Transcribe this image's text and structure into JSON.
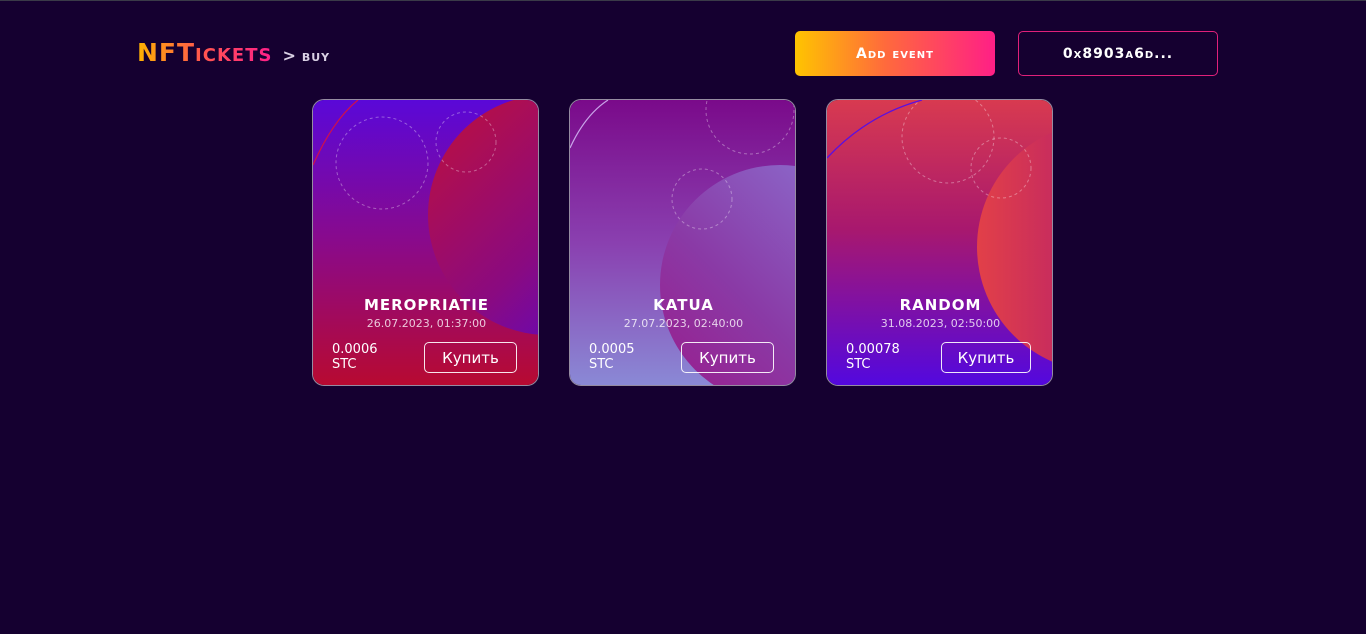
{
  "header": {
    "brand": "NFTickets",
    "separator": ">",
    "breadcrumb": "buy",
    "add_event_label": "Add event",
    "wallet_label": "0x8903a6d..."
  },
  "events": [
    {
      "title": "MEROPRIATIE",
      "date": "26.07.2023, 01:37:00",
      "price": "0.0006",
      "currency": "STC",
      "buy_label": "Купить"
    },
    {
      "title": "KATUA",
      "date": "27.07.2023, 02:40:00",
      "price": "0.0005",
      "currency": "STC",
      "buy_label": "Купить"
    },
    {
      "title": "RANDOM",
      "date": "31.08.2023, 02:50:00",
      "price": "0.00078",
      "currency": "STC",
      "buy_label": "Купить"
    }
  ],
  "colors": {
    "background": "#150030",
    "accent_orange": "#ffc400",
    "accent_pink": "#ff1f86"
  }
}
